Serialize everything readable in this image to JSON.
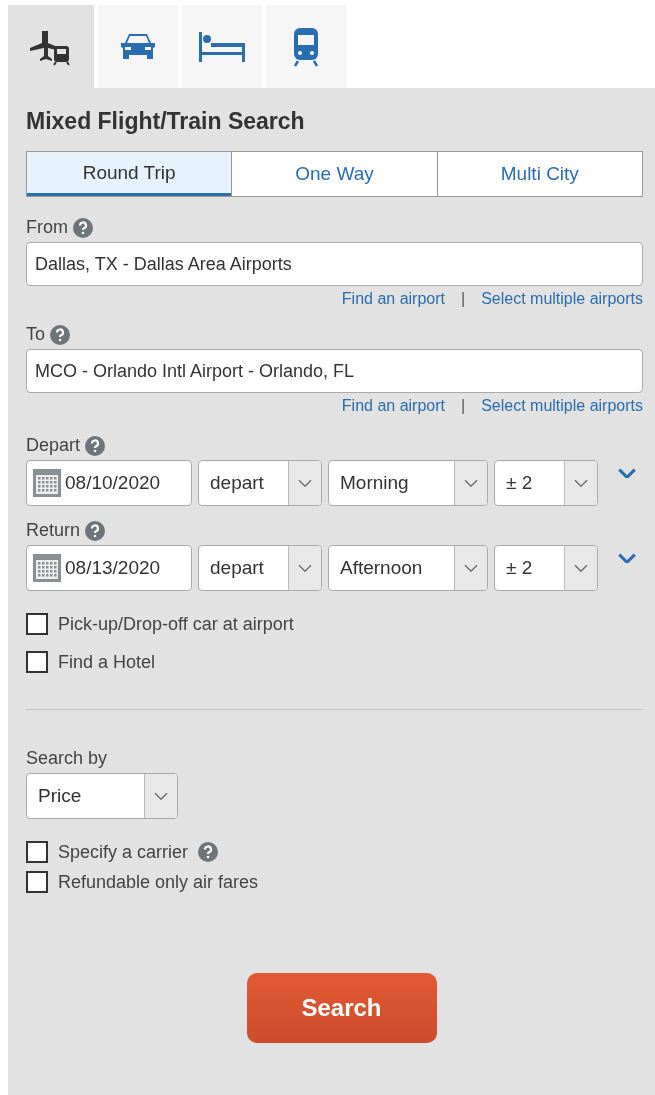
{
  "mode_tabs": [
    {
      "kind": "flight-train",
      "selected": true
    },
    {
      "kind": "car",
      "selected": false
    },
    {
      "kind": "hotel",
      "selected": false
    },
    {
      "kind": "train",
      "selected": false
    }
  ],
  "title": "Mixed Flight/Train Search",
  "trip_types": [
    {
      "label": "Round Trip",
      "selected": true
    },
    {
      "label": "One Way",
      "selected": false
    },
    {
      "label": "Multi City",
      "selected": false
    }
  ],
  "locations": [
    {
      "label": "From",
      "value": "Dallas, TX - Dallas Area Airports",
      "links": [
        "Find an airport",
        "|",
        "Select multiple airports"
      ]
    },
    {
      "label": "To",
      "value": "MCO - Orlando Intl Airport - Orlando, FL",
      "links": [
        "Find an airport",
        "|",
        "Select multiple airports"
      ]
    }
  ],
  "dates": [
    {
      "label": "Depart",
      "date": "08/10/2020",
      "type": "depart",
      "time": "Morning",
      "range": "± 2"
    },
    {
      "label": "Return",
      "date": "08/13/2020",
      "type": "depart",
      "time": "Afternoon",
      "range": "± 2"
    }
  ],
  "extras": [
    {
      "label": "Pick-up/Drop-off car at airport",
      "checked": false
    },
    {
      "label": "Find a Hotel",
      "checked": false
    }
  ],
  "search_by": {
    "label": "Search by",
    "value": "Price"
  },
  "options": [
    {
      "label": "Specify a carrier",
      "checked": false,
      "help": true
    },
    {
      "label": "Refundable only air fares",
      "checked": false,
      "help": false
    }
  ],
  "search_button": "Search"
}
